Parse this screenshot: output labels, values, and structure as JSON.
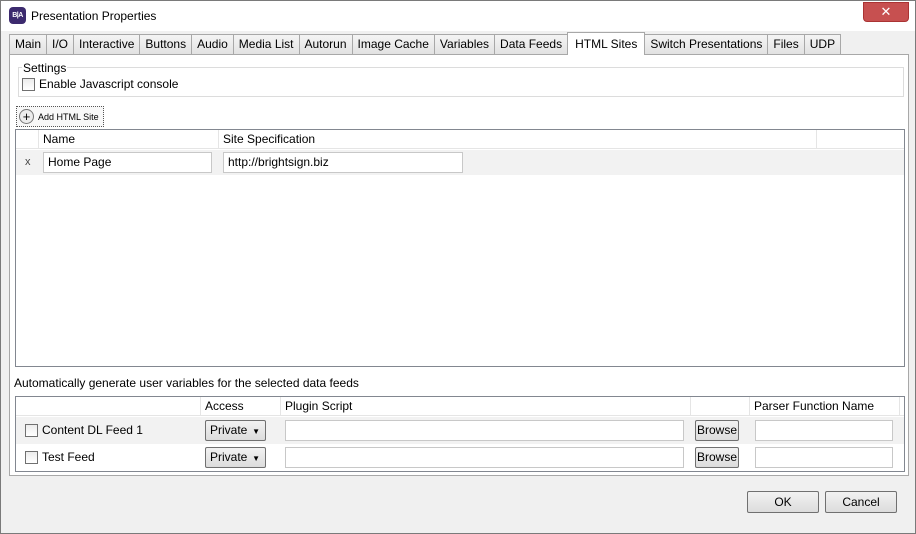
{
  "window": {
    "title": "Presentation Properties",
    "app_icon_text": "B|A",
    "close_symbol": "✕"
  },
  "tabs": [
    {
      "label": "Main"
    },
    {
      "label": "I/O"
    },
    {
      "label": "Interactive"
    },
    {
      "label": "Buttons"
    },
    {
      "label": "Audio"
    },
    {
      "label": "Media List"
    },
    {
      "label": "Autorun"
    },
    {
      "label": "Image Cache"
    },
    {
      "label": "Variables"
    },
    {
      "label": "Data Feeds"
    },
    {
      "label": "HTML Sites"
    },
    {
      "label": "Switch Presentations"
    },
    {
      "label": "Files"
    },
    {
      "label": "UDP"
    }
  ],
  "active_tab": "HTML Sites",
  "settings": {
    "group_label": "Settings",
    "js_console_label": "Enable Javascript console",
    "js_console_checked": false
  },
  "add_site_button": "Add HTML Site",
  "sites_table": {
    "columns": [
      "Name",
      "Site Specification"
    ],
    "rows": [
      {
        "delete_marker": "x",
        "name": "Home Page",
        "site_spec": "http://brightsign.biz"
      }
    ]
  },
  "feeds": {
    "label": "Automatically generate user variables for the selected data feeds",
    "columns": [
      "Access",
      "Plugin Script",
      "Parser Function Name"
    ],
    "rows": [
      {
        "name": "Content DL Feed 1",
        "checked": false,
        "access": "Private",
        "plugin_script": "",
        "browse_label": "Browse",
        "parser_function": ""
      },
      {
        "name": "Test Feed",
        "checked": false,
        "access": "Private",
        "plugin_script": "",
        "browse_label": "Browse",
        "parser_function": ""
      }
    ]
  },
  "footer": {
    "ok_label": "OK",
    "cancel_label": "Cancel"
  },
  "colors": {
    "window_bg": "#f0f0f0",
    "close_button": "#c75050",
    "selected_row": "#f2f2f2"
  }
}
